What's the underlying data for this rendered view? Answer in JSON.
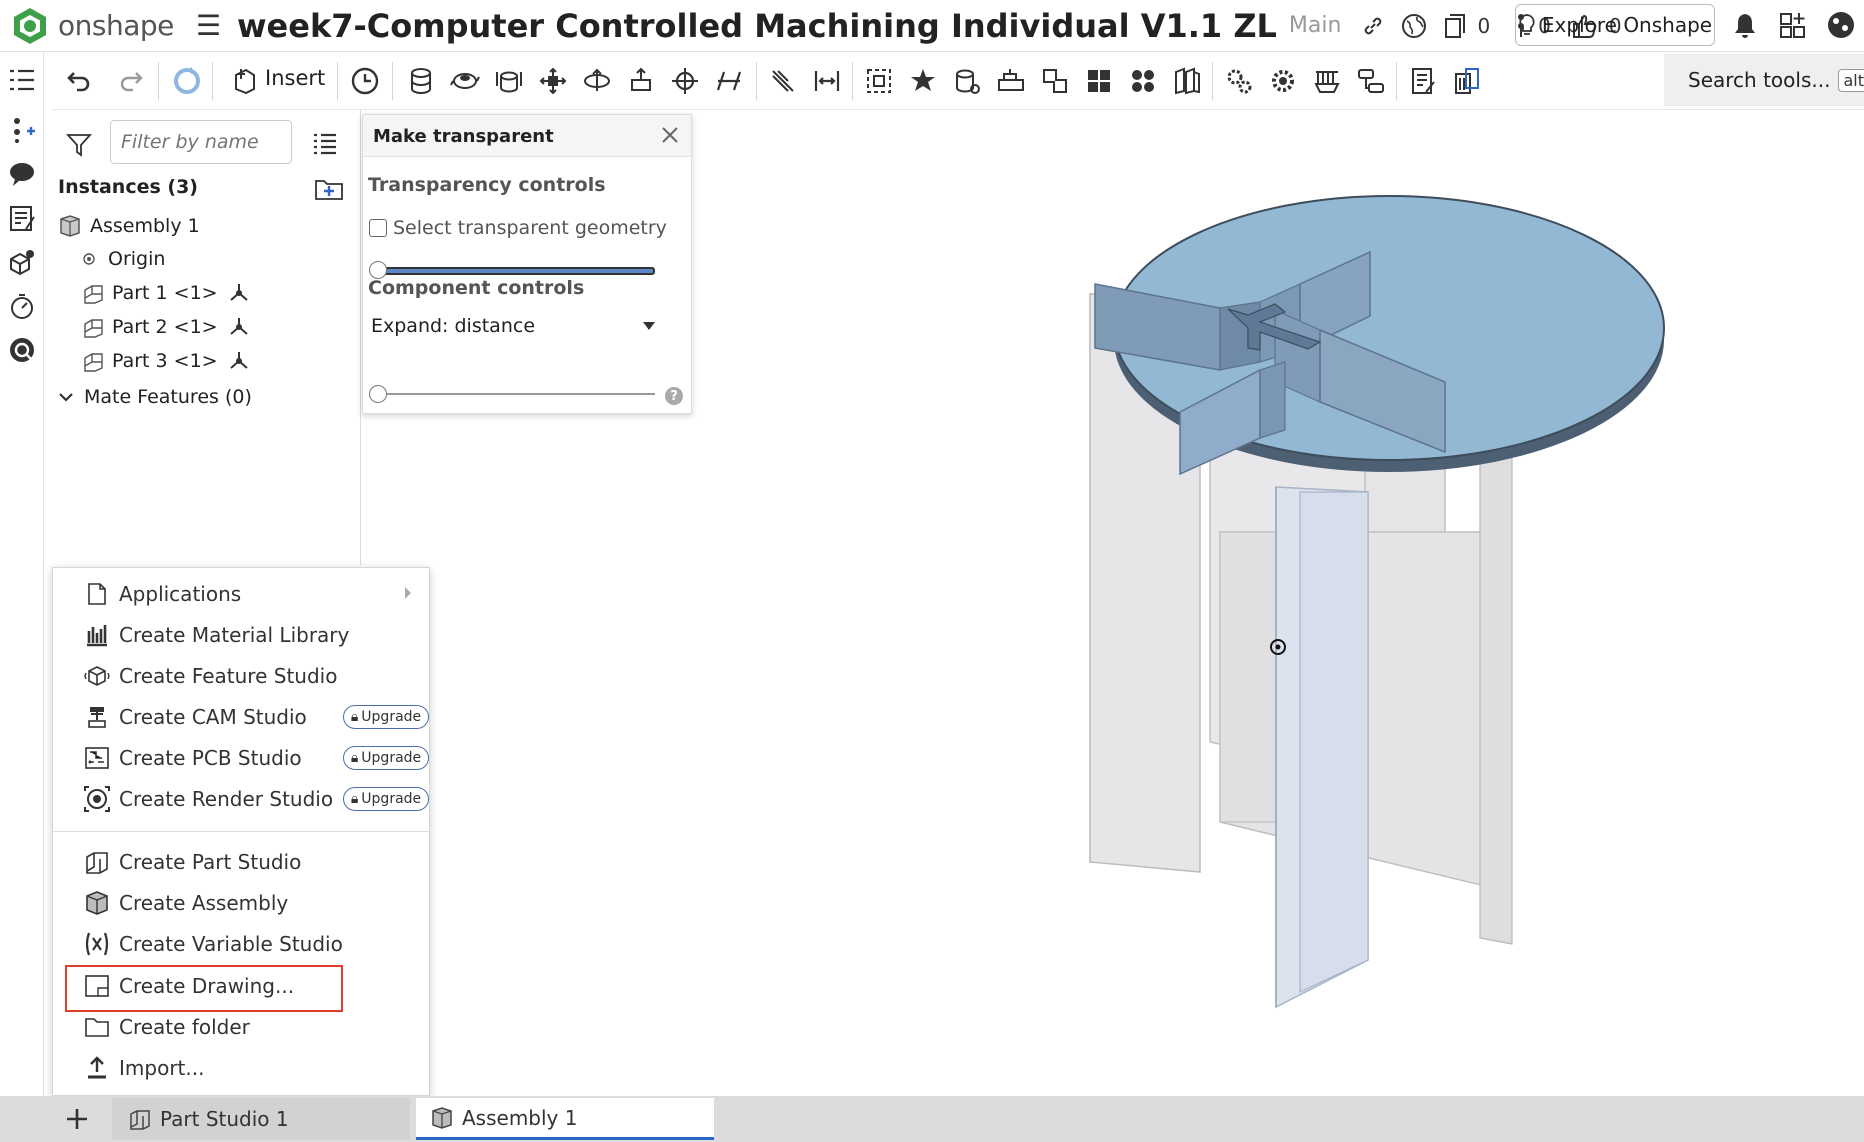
{
  "app": {
    "logo_text": "onshape",
    "doc_title": "week7-Computer Controlled Machining Individual V1.1 ZL",
    "branch": "Main",
    "versions_count": "0",
    "branches_count": "0",
    "likes_count": "0",
    "explore_label": "Explore Onshape"
  },
  "toolbar": {
    "insert_label": "Insert",
    "search_label": "Search tools...",
    "search_shortcut": "alt/⌥"
  },
  "feature_panel": {
    "filter_placeholder": "Filter by name",
    "instances_label": "Instances (3)",
    "tree": [
      {
        "label": "Assembly 1"
      },
      {
        "label": "Origin"
      },
      {
        "label": "Part 1 <1>"
      },
      {
        "label": "Part 2 <1>"
      },
      {
        "label": "Part 3 <1>"
      }
    ],
    "mate_features_label": "Mate Features (0)"
  },
  "transparency_dialog": {
    "title": "Make transparent",
    "transparency_controls": "Transparency controls",
    "select_transparent_geometry": "Select transparent geometry",
    "select_checked": false,
    "component_controls": "Component controls",
    "expand_value": "Expand: distance",
    "transparency_level": 0,
    "expand_level": 0
  },
  "context_menu": {
    "items": [
      {
        "label": "Applications",
        "icon": "document-icon",
        "submenu": true
      },
      {
        "label": "Create Material Library",
        "icon": "material-library-icon"
      },
      {
        "label": "Create Feature Studio",
        "icon": "feature-studio-icon"
      },
      {
        "label": "Create CAM Studio",
        "icon": "cam-studio-icon",
        "badge": "Upgrade"
      },
      {
        "label": "Create PCB Studio",
        "icon": "pcb-studio-icon",
        "badge": "Upgrade"
      },
      {
        "label": "Create Render Studio",
        "icon": "render-studio-icon",
        "badge": "Upgrade"
      },
      {
        "label": "Create Part Studio",
        "icon": "part-studio-icon"
      },
      {
        "label": "Create Assembly",
        "icon": "assembly-icon"
      },
      {
        "label": "Create Variable Studio",
        "icon": "variable-studio-icon"
      },
      {
        "label": "Create Drawing...",
        "icon": "drawing-icon",
        "highlighted": true
      },
      {
        "label": "Create folder",
        "icon": "folder-icon"
      },
      {
        "label": "Import...",
        "icon": "import-icon"
      }
    ]
  },
  "bottom_tabs": [
    {
      "label": "Part Studio 1",
      "active": false
    },
    {
      "label": "Assembly 1",
      "active": true
    }
  ],
  "colors": {
    "accent": "#3a7fd5",
    "highlight": "#e03c2a",
    "table_top": "#93b8d3",
    "legs": "#e4e4e6"
  }
}
